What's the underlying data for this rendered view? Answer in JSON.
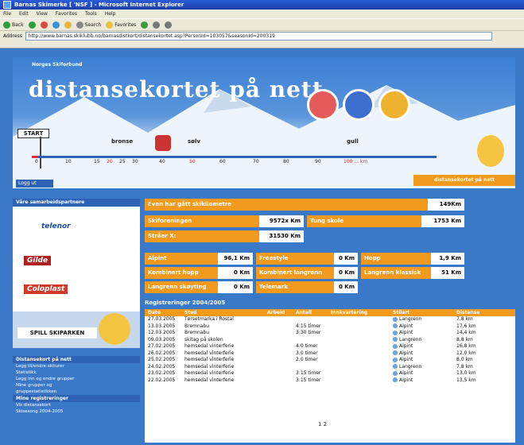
{
  "browser": {
    "title": "Barnas Skimerke [ 'NSF ] - Microsoft Internet Explorer",
    "menu": [
      "File",
      "Edit",
      "View",
      "Favorites",
      "Tools",
      "Help"
    ],
    "toolbar": {
      "back": "Back",
      "search": "Search",
      "favorites": "Favorites"
    },
    "address_label": "Address",
    "address": "http://www.barnas.skiklubb.no/barnasdistkort/distansekortet.asp?PersonId=103057&seasonId=200319"
  },
  "banner": {
    "logo_small": "Norges Skiforbund",
    "brand": "distansekortet på nett",
    "start": "START",
    "markers": [
      "bronse",
      "sølv",
      "gull"
    ],
    "scale": [
      "0",
      "10",
      "15",
      "20",
      "25",
      "30",
      "40",
      "50",
      "60",
      "70",
      "80",
      "90",
      "100 ... km"
    ],
    "left_tab": "Logg ut",
    "right_tab": "distansekortet på nett"
  },
  "sidebar": {
    "sponsors_header": "Våre samarbeidspartnere",
    "sponsors": [
      "telenor",
      "Gilde",
      "Coloplast"
    ],
    "spill_label": "SPILL SKIPARKEN",
    "links_header": "Distansekort på nett",
    "links": [
      "Legg til/endre skiturer",
      "Statistikk",
      "Legg inn og endre grupper",
      "Mine grupper og",
      "gruppestatistikken"
    ],
    "reg_header": "Mine registreringer",
    "reg_items": [
      "Vis distansekort",
      "Skisesong 2004-2005"
    ]
  },
  "summary": {
    "total_label": "Even har gått skikilometre",
    "total_value": "149Km",
    "row1": [
      {
        "label": "Skiforeningen",
        "value": "9572x Km"
      },
      {
        "label": "Tung skole",
        "value": "1753 Km"
      }
    ],
    "row2": {
      "label": "Stråer X:",
      "value": "31530 Km"
    },
    "styles": [
      {
        "label": "Alpint",
        "value": "96,1 Km"
      },
      {
        "label": "Freestyle",
        "value": "0 Km"
      },
      {
        "label": "Hopp",
        "value": "1,9 Km"
      },
      {
        "label": "Kombinert hopp",
        "value": "0 Km"
      },
      {
        "label": "Kombinert langrenn",
        "value": "0 Km"
      },
      {
        "label": "Langrenn klassisk",
        "value": "51 Km"
      },
      {
        "label": "Langrenn skøyting",
        "value": "0 Km"
      },
      {
        "label": "Telemark",
        "value": "0 Km"
      }
    ]
  },
  "registrations": {
    "title": "Registreringer 2004/2005",
    "columns": [
      "Dato",
      "Sted",
      "Arbeid",
      "Antall",
      "Innkvartering",
      "Stilart",
      "Distanse"
    ],
    "rows": [
      {
        "date": "27.03.2005",
        "place": "Tørsetmarka i Rostal",
        "time": "",
        "style": "Langrenn",
        "dist": "7,8 km"
      },
      {
        "date": "13.03.2005",
        "place": "Bremnabu",
        "time": "4:15 timer",
        "style": "Alpint",
        "dist": "17,6 km"
      },
      {
        "date": "12.03.2005",
        "place": "Bremnabu",
        "time": "3:30 timer",
        "style": "Alpint",
        "dist": "14,4 km"
      },
      {
        "date": "09.03.2005",
        "place": "skitag på skolen",
        "time": "",
        "style": "Langrenn",
        "dist": "8,8 km"
      },
      {
        "date": "27.02.2005",
        "place": "hemsedal vinterferie",
        "time": "4:0 timer",
        "style": "Alpint",
        "dist": "16,8 km"
      },
      {
        "date": "26.02.2005",
        "place": "hemsedal vinterferie",
        "time": "3:0 timer",
        "style": "Alpint",
        "dist": "12,0 km"
      },
      {
        "date": "25.02.2005",
        "place": "hemsedal vinterferie",
        "time": "2:0 timer",
        "style": "Alpint",
        "dist": "8,0 km"
      },
      {
        "date": "24.02.2005",
        "place": "hemsedal vinterferie",
        "time": "",
        "style": "Langrenn",
        "dist": "7,8 km"
      },
      {
        "date": "23.02.2005",
        "place": "hemsedal vinterferie",
        "time": "3:15 timer",
        "style": "Alpint",
        "dist": "13,0 km"
      },
      {
        "date": "22.02.2005",
        "place": "hemsedal vinterferie",
        "time": "3:15 timer",
        "style": "Alpint",
        "dist": "13,5 km"
      }
    ],
    "pager": "1 2"
  }
}
